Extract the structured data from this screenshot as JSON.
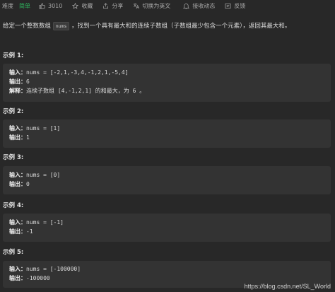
{
  "toolbar": {
    "difficulty_label": "难度",
    "difficulty_value": "简单",
    "likes": "3010",
    "favorite": "收藏",
    "share": "分享",
    "switch_lang": "切换为英文",
    "notify": "接收动态",
    "feedback": "反馈"
  },
  "description": {
    "before": "给定一个整数数组",
    "code": "nums",
    "after": "，找到一个具有最大和的连续子数组（子数组最少包含一个元素），返回其最大和。"
  },
  "examples": [
    {
      "title": "示例 1:",
      "input_label": "输入：",
      "input_value": "nums = [-2,1,-3,4,-1,2,1,-5,4]",
      "output_label": "输出：",
      "output_value": "6",
      "explain_label": "解释：",
      "explain_value": "连续子数组 [4,-1,2,1] 的和最大，为 6 。"
    },
    {
      "title": "示例 2:",
      "input_label": "输入：",
      "input_value": "nums = [1]",
      "output_label": "输出：",
      "output_value": "1"
    },
    {
      "title": "示例 3:",
      "input_label": "输入：",
      "input_value": "nums = [0]",
      "output_label": "输出：",
      "output_value": "0"
    },
    {
      "title": "示例 4:",
      "input_label": "输入：",
      "input_value": "nums = [-1]",
      "output_label": "输出：",
      "output_value": "-1"
    },
    {
      "title": "示例 5:",
      "input_label": "输入：",
      "input_value": "nums = [-100000]",
      "output_label": "输出：",
      "output_value": "-100000"
    }
  ],
  "watermark": "https://blog.csdn.net/SL_World",
  "colors": {
    "background": "#282828",
    "difficulty_easy": "#2db55d",
    "example_box": "#333333"
  }
}
